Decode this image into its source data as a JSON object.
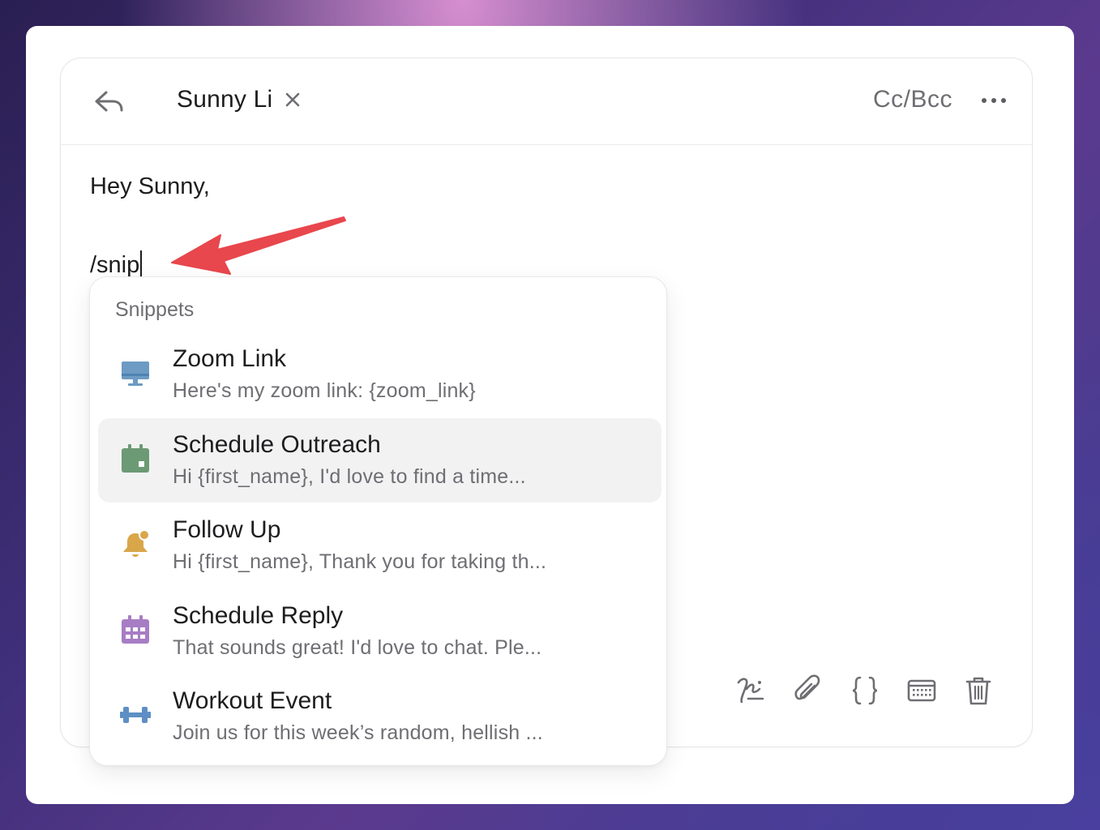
{
  "header": {
    "reply_icon": "reply-icon",
    "recipient": "Sunny Li",
    "remove_icon": "close-icon",
    "ccbcc": "Cc/Bcc",
    "more_icon": "ellipsis-icon"
  },
  "body": {
    "greeting": "Hey Sunny,",
    "command": "/snip"
  },
  "snippets": {
    "title": "Snippets",
    "items": [
      {
        "title": "Zoom Link",
        "preview": "Here's my zoom link: {zoom_link}",
        "icon": "monitor-icon",
        "color": "#6d9bc3"
      },
      {
        "title": "Schedule Outreach",
        "preview": "Hi {first_name}, I'd love to find a time...",
        "icon": "calendar-icon",
        "color": "#6c9a74"
      },
      {
        "title": "Follow Up",
        "preview": "Hi {first_name}, Thank you for taking th...",
        "icon": "bell-icon",
        "color": "#d9a64a"
      },
      {
        "title": "Schedule Reply",
        "preview": "That sounds great! I'd love to chat. Ple...",
        "icon": "calendar-grid-icon",
        "color": "#a77dc4"
      },
      {
        "title": "Workout Event",
        "preview": "Join us for this week’s random, hellish ...",
        "icon": "dumbbell-icon",
        "color": "#5e8fc4"
      }
    ],
    "active_index": 1
  },
  "toolbar": {
    "icons": [
      "signature-icon",
      "paperclip-icon",
      "braces-icon",
      "keyboard-icon",
      "trash-icon"
    ]
  },
  "colors": {
    "annotation_arrow": "#e8474d",
    "hover_bg": "#f2f2f3"
  }
}
